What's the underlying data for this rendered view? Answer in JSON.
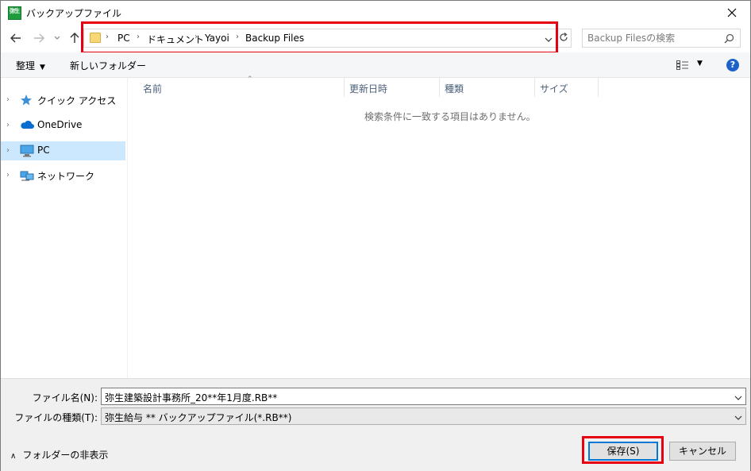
{
  "window": {
    "title": "バックアップファイル",
    "app_icon_text": "弥生",
    "accent_highlight_color": "#e60012"
  },
  "nav": {
    "back_icon": "arrow-left-icon",
    "forward_icon": "arrow-right-icon",
    "recent_icon": "chevron-down-icon",
    "up_icon": "arrow-up-icon",
    "breadcrumb": [
      "PC",
      "ドキュメント",
      "Yayoi",
      "Backup Files"
    ],
    "search_placeholder": "Backup Filesの検索"
  },
  "toolbar": {
    "organize_label": "整理",
    "new_folder_label": "新しいフォルダー"
  },
  "sidebar": {
    "items": [
      {
        "label": "クイック アクセス",
        "icon": "star-icon",
        "selected": false
      },
      {
        "label": "OneDrive",
        "icon": "cloud-icon",
        "selected": false
      },
      {
        "label": "PC",
        "icon": "computer-icon",
        "selected": true
      },
      {
        "label": "ネットワーク",
        "icon": "network-icon",
        "selected": false
      }
    ]
  },
  "filelist": {
    "columns": [
      "名前",
      "更新日時",
      "種類",
      "サイズ"
    ],
    "empty_message": "検索条件に一致する項目はありません。"
  },
  "bottom": {
    "filename_label": "ファイル名(N):",
    "filename_value": "弥生建築設計事務所_20**年1月度.RB**",
    "filetype_label": "ファイルの種類(T):",
    "filetype_value": "弥生給与 ** バックアップファイル(*.RB**)",
    "hide_folders_label": "フォルダーの非表示",
    "save_label": "保存(S)",
    "cancel_label": "キャンセル"
  }
}
